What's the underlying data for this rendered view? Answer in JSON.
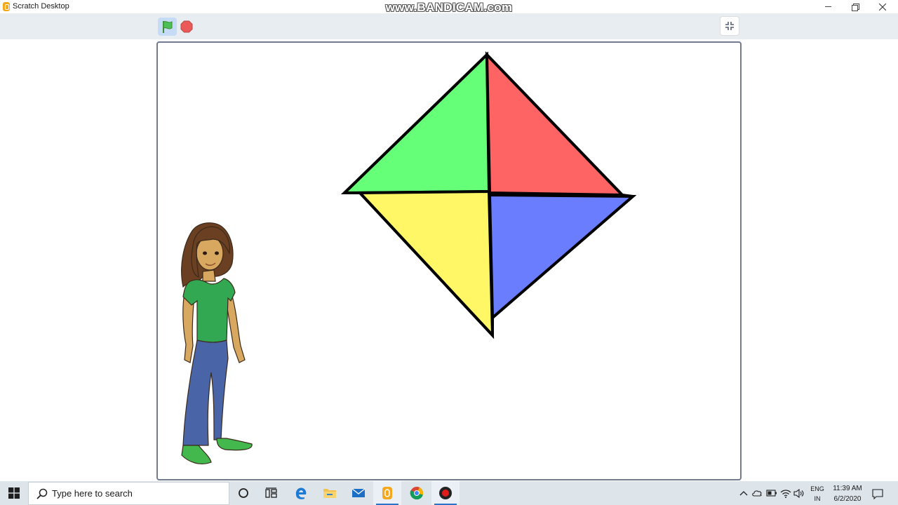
{
  "window": {
    "title": "Scratch Desktop",
    "watermark": "www.BANDICAM.com"
  },
  "controls": {
    "green_flag_icon": "green-flag-icon",
    "stop_icon": "stop-sign-icon",
    "fullscreen_icon": "unfullscreen-icon"
  },
  "stage": {
    "shape_colors": {
      "top_left": "#66ff78",
      "top_right": "#ff6464",
      "bottom_left": "#fff765",
      "bottom_right": "#6a7dff"
    },
    "sprite": "girl-sprite"
  },
  "taskbar": {
    "search_placeholder": "Type here to search",
    "apps": [
      "cortana-icon",
      "task-view-icon",
      "edge-icon",
      "file-explorer-icon",
      "mail-icon",
      "scratch-icon",
      "chrome-icon",
      "bandicam-icon"
    ],
    "tray": {
      "lang_line1": "ENG",
      "lang_line2": "IN",
      "time": "11:39 AM",
      "date": "6/2/2020"
    }
  }
}
